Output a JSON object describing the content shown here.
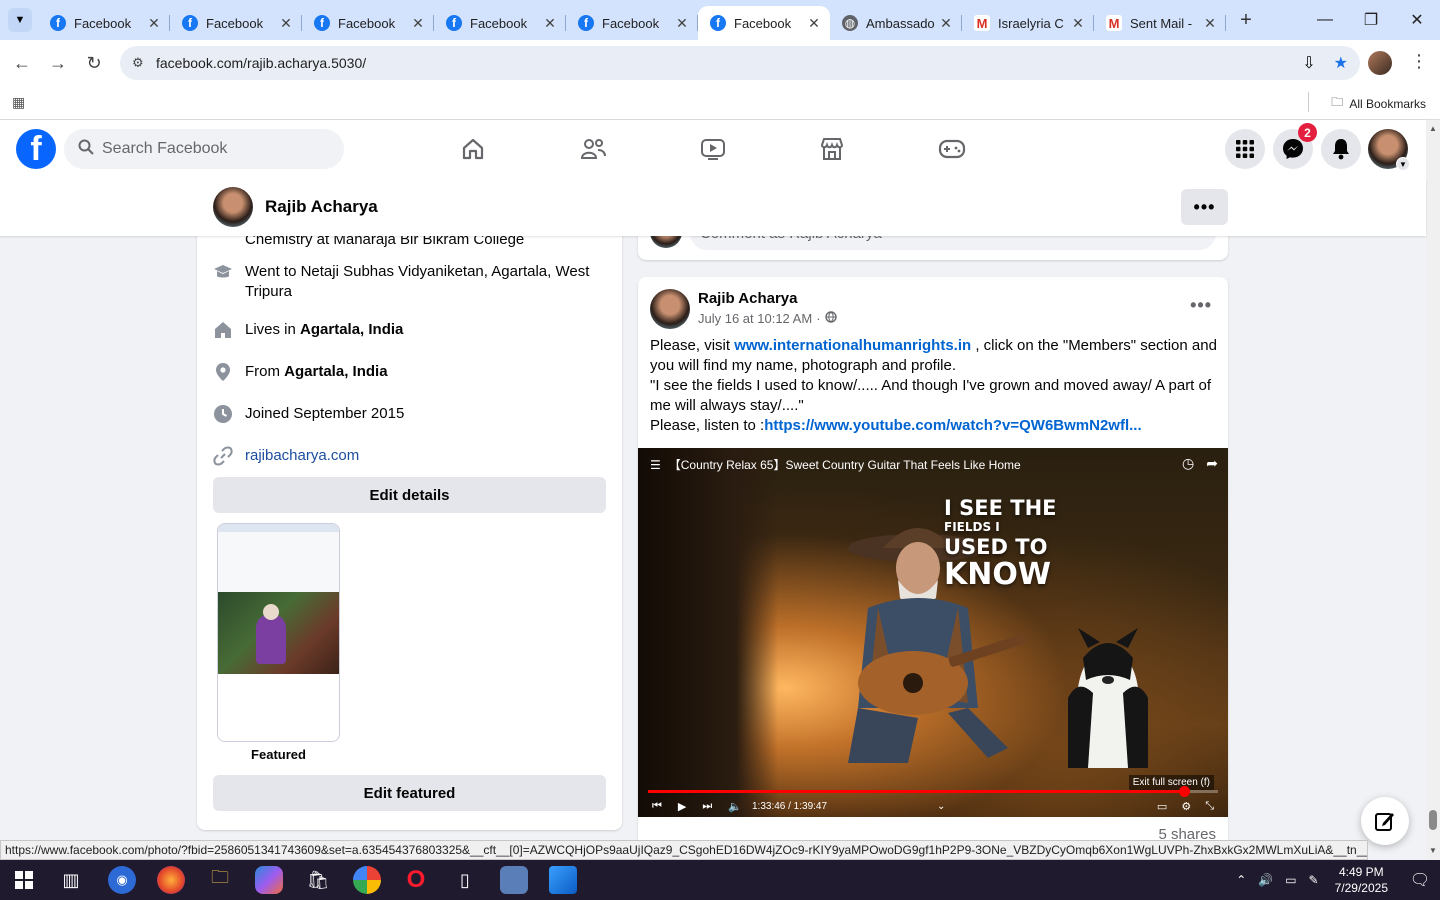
{
  "browser": {
    "tabs": [
      {
        "label": "Facebook",
        "icon": "facebook-icon",
        "active": false
      },
      {
        "label": "Facebook",
        "icon": "facebook-icon",
        "active": false
      },
      {
        "label": "Facebook",
        "icon": "facebook-icon",
        "active": false
      },
      {
        "label": "Facebook",
        "icon": "facebook-icon",
        "active": false
      },
      {
        "label": "Facebook",
        "icon": "facebook-icon",
        "active": false
      },
      {
        "label": "Facebook",
        "icon": "facebook-icon",
        "active": true
      },
      {
        "label": "Ambassado",
        "icon": "globe-icon",
        "active": false
      },
      {
        "label": "Israelyria C",
        "icon": "gmail-icon",
        "active": false
      },
      {
        "label": "Sent Mail -",
        "icon": "gmail-icon",
        "active": false
      }
    ],
    "url": "facebook.com/rajib.acharya.5030/",
    "all_bookmarks": "All Bookmarks",
    "status_link": "https://www.facebook.com/photo/?fbid=2586051341743609&set=a.635454376803325&__cft__[0]=AZWCQHjOPs9aaUjIQaz9_CSgohED16DW4jZOc9-rKIY9yaMPOwoDG9gf1hP2P9-3ONe_VBZDyCyOmqb6Xon1WgLUVPh-ZhxBxkGx2MWLmXuLiA&__tn__=EH-R"
  },
  "fb": {
    "search_placeholder": "Search Facebook",
    "messenger_badge": "2",
    "accent": "#0866ff"
  },
  "profile": {
    "name": "Rajib Acharya",
    "more_label": "•••"
  },
  "intro": {
    "partial_line": "Chemistry at Maharaja Bir Bikram College",
    "education": "Went to Netaji Subhas Vidyaniketan, Agartala, West Tripura",
    "lives_prefix": "Lives in ",
    "lives_place": "Agartala, India",
    "from_prefix": "From ",
    "from_place": "Agartala, India",
    "joined": "Joined September 2015",
    "website": "rajibacharya.com",
    "edit_details": "Edit details",
    "featured_label": "Featured",
    "edit_featured": "Edit featured"
  },
  "comment_box": {
    "placeholder": "Comment as Rajib Acharya"
  },
  "post": {
    "author": "Rajib Acharya",
    "time": "July 16 at 10:12 AM",
    "separator": "·",
    "text_1_prefix": "Please, visit ",
    "text_1_link": "www.internationalhumanrights.in",
    "text_1_suffix": " , click on the \"Members\" section and you will find my name, photograph and profile.",
    "text_2": "\"I see the fields I used to know/..... And though I've grown and moved away/ A part of me will always stay/....\"",
    "text_3_prefix": "Please, listen to :",
    "text_3_link": "https://www.youtube.com/watch?v=QW6BwmN2wfl...",
    "shares": "5 shares",
    "video": {
      "title": "【Country Relax 65】Sweet Country Guitar That Feels Like Home",
      "overlay_1": "I SEE THE",
      "overlay_2": "FIELDS I",
      "overlay_3": "USED TO",
      "overlay_4": "KNOW",
      "exit_fullscreen": "Exit full screen (f)",
      "time": "1:33:46 / 1:39:47",
      "progress": 0.94
    }
  },
  "taskbar": {
    "time": "4:49 PM",
    "date": "7/29/2025"
  }
}
